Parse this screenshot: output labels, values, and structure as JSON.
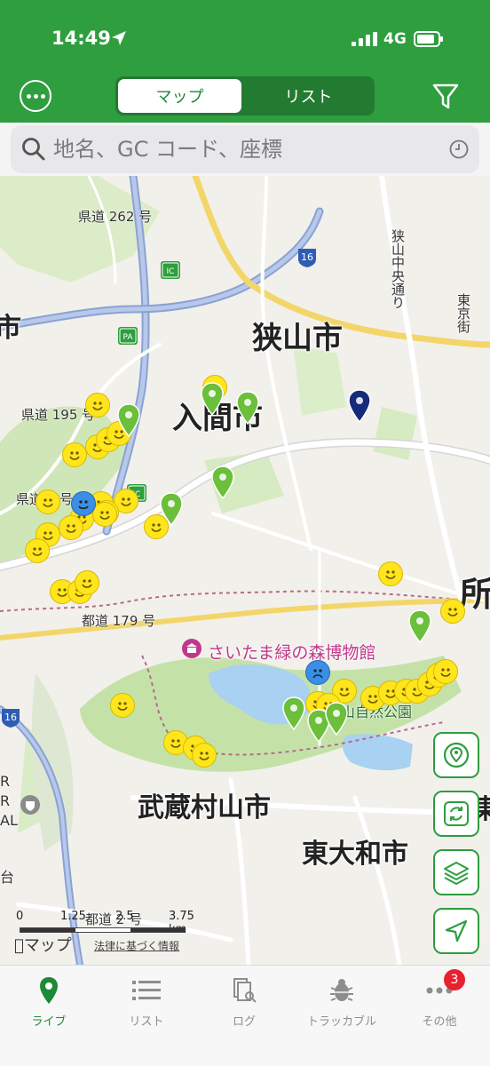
{
  "status": {
    "time": "14:49",
    "network": "4G"
  },
  "header": {
    "segments": [
      "マップ",
      "リスト"
    ],
    "selected": "マップ"
  },
  "search": {
    "placeholder": "地名、GC コード、座標"
  },
  "map": {
    "places": {
      "sayama": "狭山市",
      "iruma": "入間市",
      "musashimurayama": "武蔵村山市",
      "higashiyamato": "東大和市",
      "tokorozawa_partial": "所",
      "left_partial": "市",
      "right_partial": "東"
    },
    "roads": {
      "kendo262": "県道 262 号",
      "kendo195": "県道 195 号",
      "kendo_partial": "県道 3 号",
      "todo179": "都道 179 号",
      "sayama_chuo": "狭山中央通り",
      "right_road": "東京街",
      "todo_lower": "都道 2 号"
    },
    "shields": {
      "r16a": "16",
      "r16b": "16",
      "ic1": "IC",
      "ic2": "IC",
      "pa": "PA"
    },
    "poi": "さいたま緑の森博物館",
    "park_label": "山自然公園",
    "airbase_letters": [
      "R",
      "R",
      "AL"
    ],
    "left_edge_letter": "台",
    "scale_labels": [
      "0",
      "1.25",
      "2.5",
      "3.75 km"
    ],
    "maps_logo": "マップ",
    "legal": "法律に基づく情報"
  },
  "tabbar": {
    "tabs": [
      "ライブ",
      "リスト",
      "ログ",
      "トラッカブル",
      "その他"
    ],
    "active": "ライブ",
    "badge": "3"
  },
  "colors": {
    "brand_green": "#2e9e3f",
    "cache_yellow": "#ffe51c",
    "pin_green": "#6bbf3a",
    "pin_navy": "#152a7a"
  }
}
